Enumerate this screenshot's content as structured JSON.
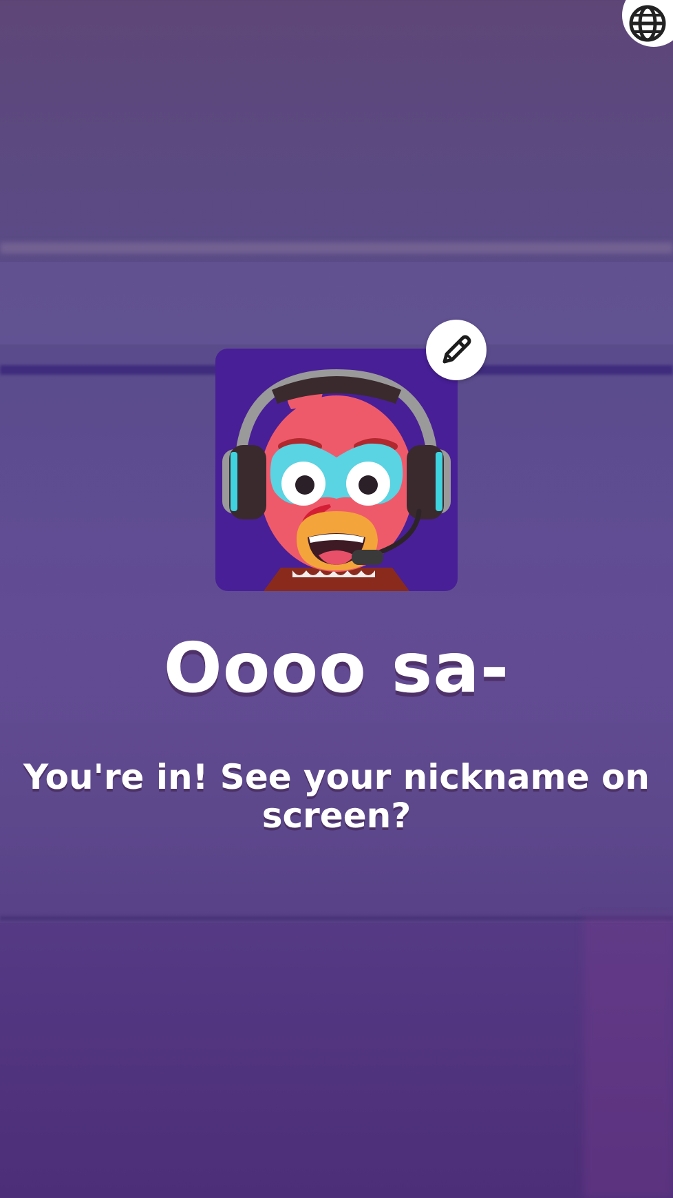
{
  "header": {
    "language_icon": "globe-icon"
  },
  "profile": {
    "avatar": "turkey-gamer-avatar",
    "edit_icon": "pencil-icon",
    "nickname": "Oooo sa-"
  },
  "message": {
    "text": "You're in! See your nickname on screen?"
  },
  "colors": {
    "avatar_bg": "#481f97",
    "text": "#ffffff",
    "button_bg": "#ffffff"
  }
}
